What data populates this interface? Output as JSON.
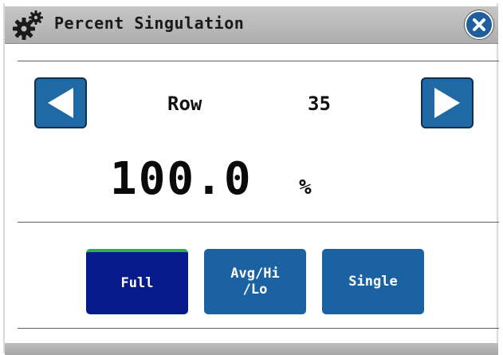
{
  "window": {
    "title": "Percent Singulation",
    "title_icon": "gears-icon",
    "close_icon": "close-icon"
  },
  "row": {
    "label": "Row",
    "value": "35",
    "prev_icon": "arrow-left-icon",
    "next_icon": "arrow-right-icon"
  },
  "reading": {
    "value": "100.0",
    "unit": "%"
  },
  "modes": [
    {
      "label": "Full",
      "selected": true
    },
    {
      "label": "Avg/Hi\n/Lo",
      "selected": false
    },
    {
      "label": "Single",
      "selected": false
    }
  ],
  "colors": {
    "selected_button": "#061a8c",
    "button": "#1b62a3",
    "selected_indicator": "#2fb14a",
    "close_button": "#1f5fa0"
  }
}
